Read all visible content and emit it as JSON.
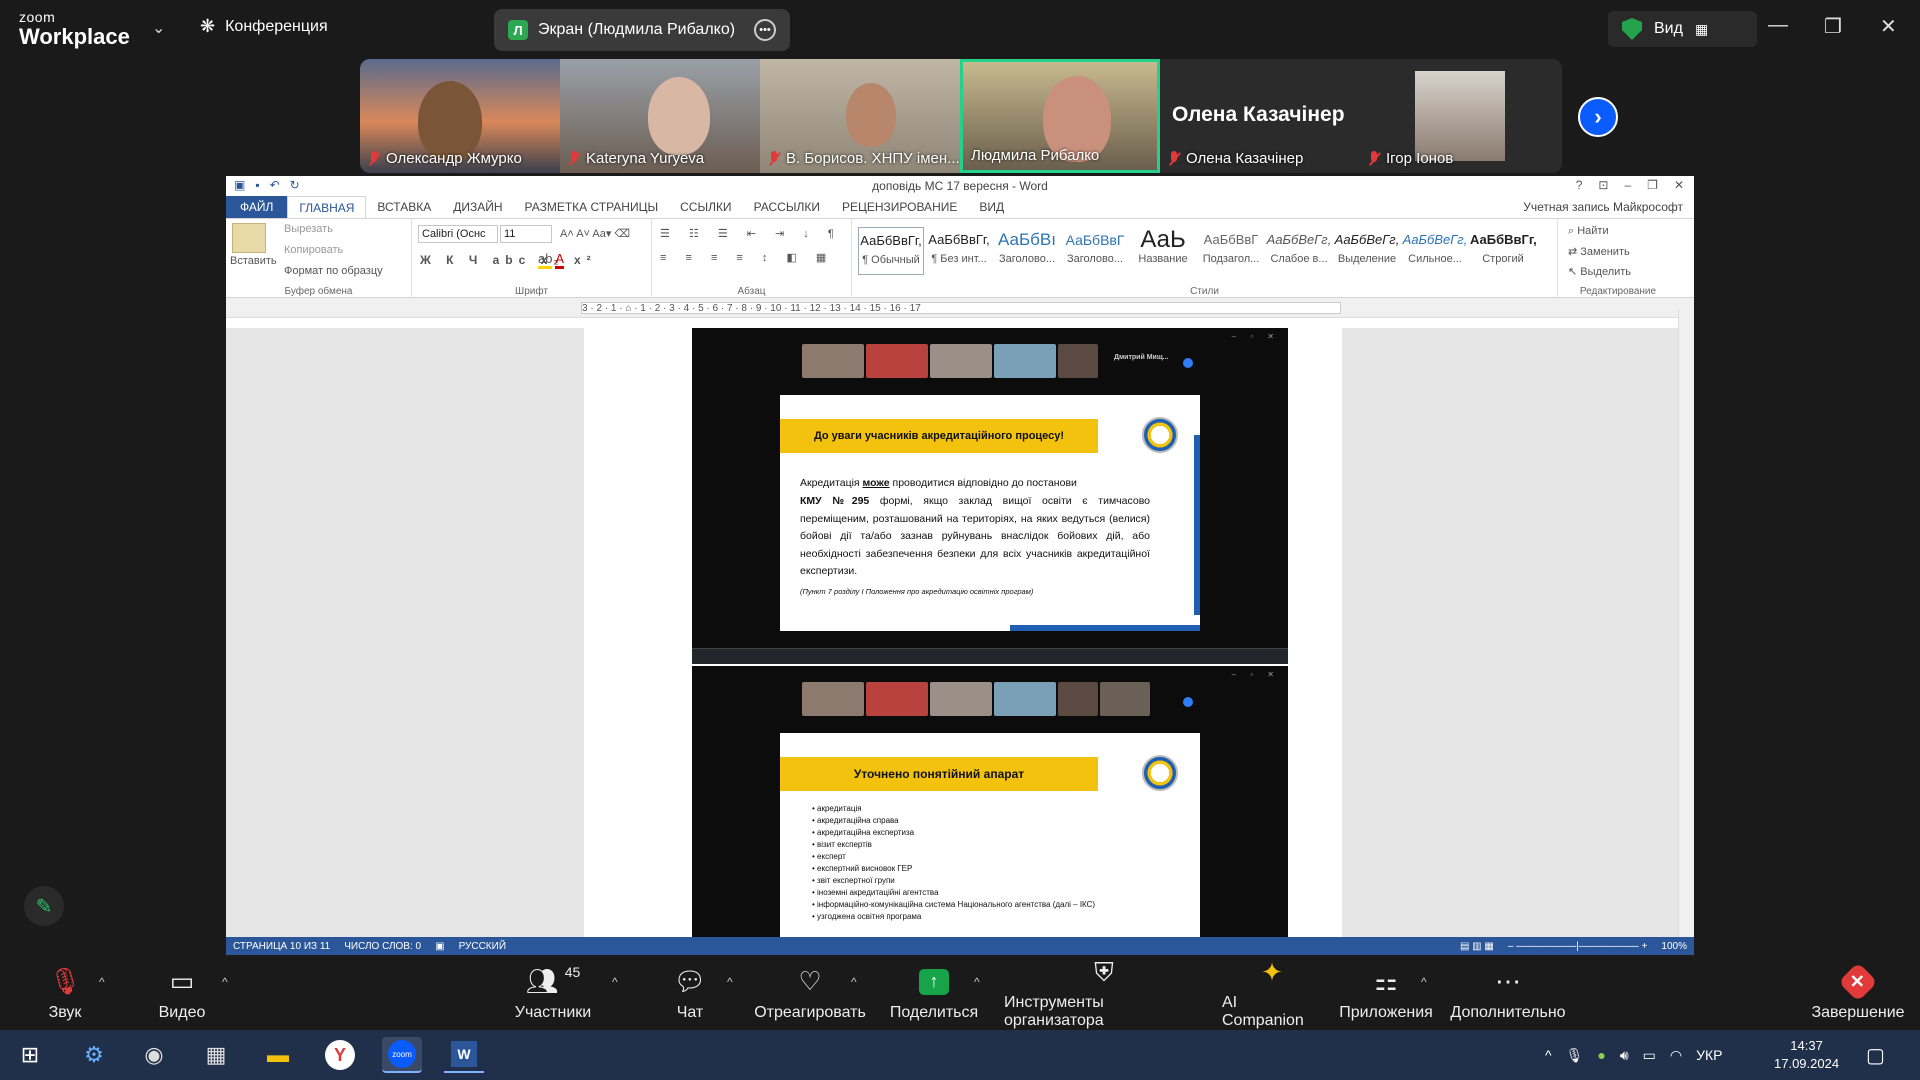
{
  "zoom": {
    "logo_top": "zoom",
    "logo_bottom": "Workplace",
    "meeting_label": "Конференция",
    "screen_share": {
      "avatar_letter": "Л",
      "label": "Экран (Людмила Рибалко)"
    },
    "view_label": "Вид",
    "participants": [
      {
        "name": "Олександр Жмурко"
      },
      {
        "name": "Kateryna Yuryeva"
      },
      {
        "name": "В. Борисов. ХНПУ імен..."
      },
      {
        "name": "Людмила Рибалко"
      },
      {
        "name": "Олена Казачінер",
        "big_label": "Олена Казачінер"
      },
      {
        "name": "Ігор Іонов"
      }
    ],
    "toolbar": {
      "audio": "Звук",
      "video": "Видео",
      "participants": "Участники",
      "participants_count": "45",
      "chat": "Чат",
      "react": "Отреагировать",
      "share": "Поделиться",
      "host_tools": "Инструменты организатора",
      "ai": "AI Companion",
      "apps": "Приложения",
      "more": "Дополнительно",
      "end": "Завершение"
    }
  },
  "word": {
    "title": "доповідь МС 17 вересня - Word",
    "account": "Учетная запись Майкрософт",
    "tabs": [
      "ФАЙЛ",
      "ГЛАВНАЯ",
      "ВСТАВКА",
      "ДИЗАЙН",
      "РАЗМЕТКА СТРАНИЦЫ",
      "ССЫЛКИ",
      "РАССЫЛКИ",
      "РЕЦЕНЗИРОВАНИЕ",
      "ВИД"
    ],
    "clipboard": {
      "paste": "Вставить",
      "cut": "Вырезать",
      "copy": "Копировать",
      "format_painter": "Формат по образцу",
      "group": "Буфер обмена"
    },
    "font": {
      "name": "Calibri (Оснс",
      "size": "11",
      "group": "Шрифт"
    },
    "paragraph_group": "Абзац",
    "styles": [
      {
        "preview": "АаБбВвГг,",
        "name": "¶ Обычный"
      },
      {
        "preview": "АаБбВвГг,",
        "name": "¶ Без инт..."
      },
      {
        "preview": "АаБбВı",
        "name": "Заголово..."
      },
      {
        "preview": "АаБбВвГ",
        "name": "Заголово..."
      },
      {
        "preview": "АаЬ",
        "name": "Название"
      },
      {
        "preview": "АаБбВвГ",
        "name": "Подзагол..."
      },
      {
        "preview": "АаБбВеГг,",
        "name": "Слабое в..."
      },
      {
        "preview": "АаБбВеГг,",
        "name": "Выделение"
      },
      {
        "preview": "АаБбВеГг,",
        "name": "Сильное..."
      },
      {
        "preview": "АаБбВвГг,",
        "name": "Строгий"
      }
    ],
    "styles_group": "Стили",
    "editing": {
      "find": "Найти",
      "replace": "Заменить",
      "select": "Выделить",
      "group": "Редактирование"
    },
    "ruler": "3 · 2 · 1 · ⌂ · 1 · 2 · 3 · 4 · 5 · 6 · 7 · 8 · 9 · 10 · 11 · 12 · 13 · 14 · 15 · 16 · 17",
    "status": {
      "page": "СТРАНИЦА 10 ИЗ 11",
      "words": "ЧИСЛО СЛОВ: 0",
      "lang": "РУССКИЙ",
      "zoom": "100%"
    }
  },
  "slide1": {
    "mini_name": "Дмитрий Мищ...",
    "banner": "До уваги учасників акредитаційного процесу!",
    "line1_pre": "Акредитація ",
    "line1_bold": "може",
    "line1_post": " проводитися відповідно до постанови",
    "body_bold": "КМУ №295",
    "body": " формі, якщо заклад вищої освіти є тимчасово переміщеним, розташований на територіях, на яких ведуться (велися) бойові дії та/або зазнав руйнувань внаслідок бойових дій, або необхідності забезпечення безпеки для всіх учасників акредитаційної експертизи.",
    "note": "(Пункт 7 розділу І Положення про акредитацію освітніх програм)"
  },
  "slide2": {
    "banner": "Уточнено понятійний апарат",
    "items": [
      "акредитація",
      "акредитаційна справа",
      "акредитаційна експертиза",
      "візит експертів",
      "експерт",
      "експертний висновок ГЕР",
      "звіт експертної групи",
      "іноземні акредитаційні агентства",
      "інформаційно-комунікаційна система Національного агентства (далі – ІКС)",
      "узгоджена освітня програма"
    ]
  },
  "taskbar": {
    "lang": "УКР",
    "time": "14:37",
    "date": "17.09.2024"
  }
}
